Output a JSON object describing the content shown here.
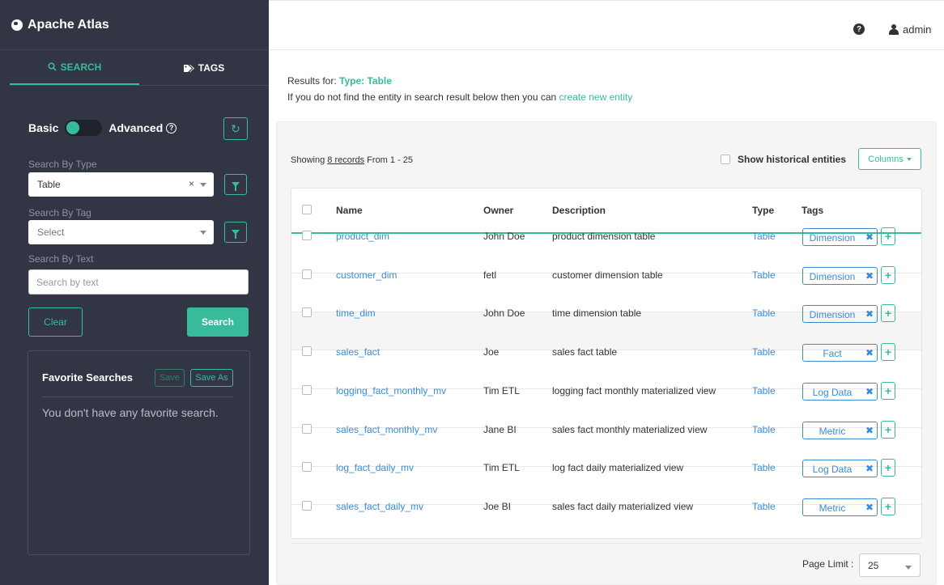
{
  "app": {
    "title": "Apache Atlas"
  },
  "sidebar": {
    "tabs": [
      {
        "label": "SEARCH"
      },
      {
        "label": "TAGS"
      }
    ],
    "toggle": {
      "left": "Basic",
      "right": "Advanced"
    },
    "type": {
      "label": "Search By Type",
      "value": "Table"
    },
    "tag": {
      "label": "Search By Tag",
      "value": "Select"
    },
    "text": {
      "label": "Search By Text",
      "placeholder": "Search by text"
    },
    "clear": "Clear",
    "search": "Search",
    "favorites": {
      "title": "Favorite Searches",
      "save": "Save",
      "save_as": "Save As",
      "empty": "You don't have any favorite search."
    }
  },
  "header": {
    "help": "?",
    "user": "admin"
  },
  "results": {
    "prefix": "Results for: ",
    "query": "Type: Table",
    "hint": "If you do not find the entity in search result below then you can ",
    "create_link": "create new entity",
    "showing_pre": "Showing ",
    "showing_count": "8 records",
    "showing_post": " From 1 - 25",
    "historical": "Show historical entities",
    "columns": "Columns"
  },
  "table": {
    "headers": [
      "Name",
      "Owner",
      "Description",
      "Type",
      "Tags"
    ],
    "rows": [
      {
        "name": "product_dim",
        "owner": "John Doe",
        "description": "product dimension table",
        "type": "Table",
        "tag": "Dimension"
      },
      {
        "name": "customer_dim",
        "owner": "fetl",
        "description": "customer dimension table",
        "type": "Table",
        "tag": "Dimension"
      },
      {
        "name": "time_dim",
        "owner": "John Doe",
        "description": "time dimension table",
        "type": "Table",
        "tag": "Dimension"
      },
      {
        "name": "sales_fact",
        "owner": "Joe",
        "description": "sales fact table",
        "type": "Table",
        "tag": "Fact"
      },
      {
        "name": "logging_fact_monthly_mv",
        "owner": "Tim ETL",
        "description": "logging fact monthly materialized view",
        "type": "Table",
        "tag": "Log Data"
      },
      {
        "name": "sales_fact_monthly_mv",
        "owner": "Jane BI",
        "description": "sales fact monthly materialized view",
        "type": "Table",
        "tag": "Metric"
      },
      {
        "name": "log_fact_daily_mv",
        "owner": "Tim ETL",
        "description": "log fact daily materialized view",
        "type": "Table",
        "tag": "Log Data"
      },
      {
        "name": "sales_fact_daily_mv",
        "owner": "Joe BI",
        "description": "sales fact daily materialized view",
        "type": "Table",
        "tag": "Metric"
      }
    ]
  },
  "pagination": {
    "label": "Page Limit :",
    "value": "25"
  }
}
